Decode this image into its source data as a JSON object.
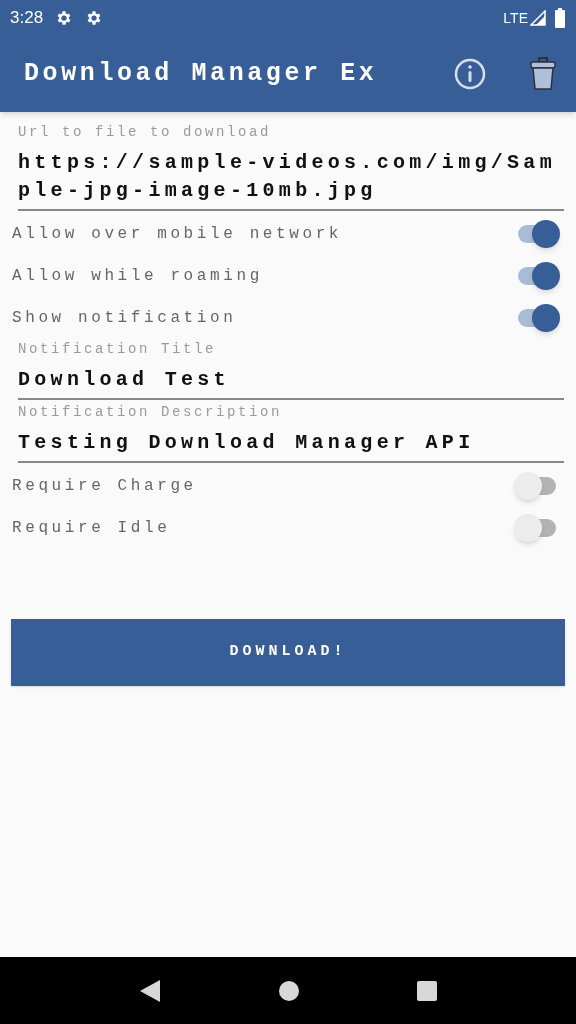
{
  "status_bar": {
    "time": "3:28",
    "network": "LTE"
  },
  "app_bar": {
    "title": "Download Manager Ex"
  },
  "form": [
    {
      "kind": "field",
      "label": "Url to file to download",
      "value": "https://sample-videos.com/img/Sample-jpg-image-10mb.jpg"
    },
    {
      "kind": "switch",
      "label": "Allow over mobile network",
      "on": true
    },
    {
      "kind": "switch",
      "label": "Allow while roaming",
      "on": true
    },
    {
      "kind": "switch",
      "label": "Show notification",
      "on": true
    },
    {
      "kind": "field",
      "label": "Notification Title",
      "value": "Download Test"
    },
    {
      "kind": "field",
      "label": "Notification Description",
      "value": "Testing Download Manager API"
    },
    {
      "kind": "switch",
      "label": "Require Charge",
      "on": false
    },
    {
      "kind": "switch",
      "label": "Require Idle",
      "on": false
    }
  ],
  "button": {
    "label": "DOWNLOAD!"
  }
}
